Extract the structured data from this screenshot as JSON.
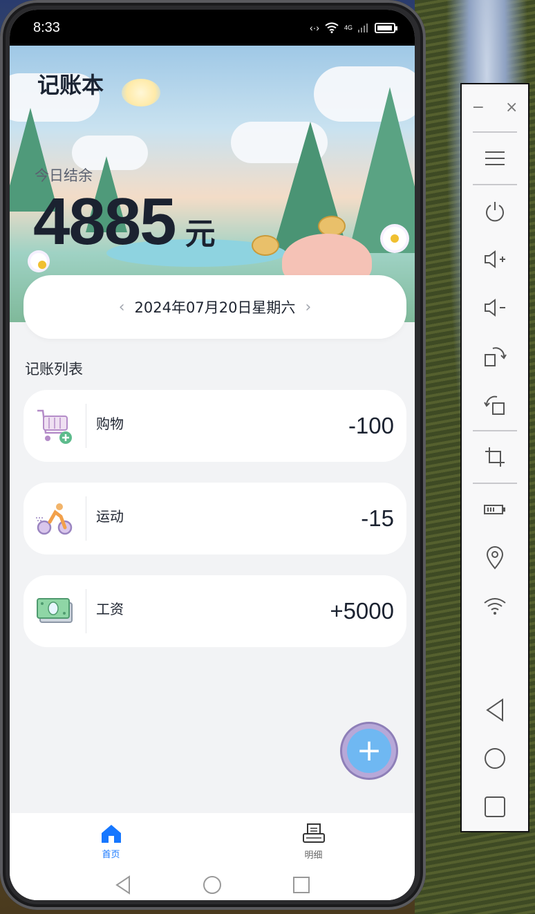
{
  "status_bar": {
    "time": "8:33",
    "network": "4G"
  },
  "app": {
    "title": "记账本"
  },
  "summary": {
    "label": "今日结余",
    "value": "4885",
    "unit": "元"
  },
  "date_selector": {
    "prev": "‹",
    "date": "2024年07月20日星期六",
    "next": "›"
  },
  "list": {
    "title": "记账列表",
    "records": [
      {
        "icon": "shopping-cart-icon",
        "name": "购物",
        "amount": "-100"
      },
      {
        "icon": "cycling-icon",
        "name": "运动",
        "amount": "-15"
      },
      {
        "icon": "money-icon",
        "name": "工资",
        "amount": "+5000"
      }
    ]
  },
  "fab": {
    "label": "+"
  },
  "tabs": [
    {
      "label": "首页",
      "icon": "home-icon",
      "active": true,
      "color": "#1677ff"
    },
    {
      "label": "明细",
      "icon": "receipt-icon",
      "active": false,
      "color": "#666666"
    }
  ],
  "colors": {
    "accent": "#1677ff",
    "fab": "#6fb8f2",
    "background": "#f2f3f5"
  }
}
